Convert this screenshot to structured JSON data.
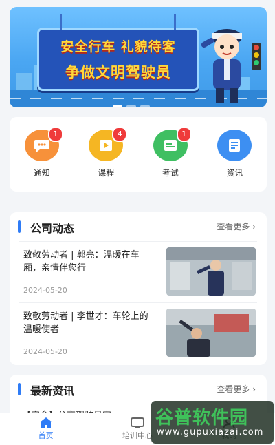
{
  "banner": {
    "line1": "安全行车 礼貌待客",
    "line2": "争做文明驾驶员"
  },
  "menu": [
    {
      "label": "通知",
      "icon": "chat-bubble-icon",
      "badge": "1",
      "color": "#f7913a"
    },
    {
      "label": "课程",
      "icon": "video-play-icon",
      "badge": "4",
      "color": "#f5b623"
    },
    {
      "label": "考试",
      "icon": "edit-note-icon",
      "badge": "1",
      "color": "#3fbf62"
    },
    {
      "label": "资讯",
      "icon": "document-icon",
      "badge": "",
      "color": "#3d8ff2"
    }
  ],
  "company": {
    "title": "公司动态",
    "more": "查看更多 ›",
    "items": [
      {
        "text": "致敬劳动者 | 郭亮：温暖在车厢，亲情伴您行",
        "date": "2024-05-20"
      },
      {
        "text": "致敬劳动者 | 李世才：车轮上的温暖使者",
        "date": "2024-05-20"
      }
    ]
  },
  "latest": {
    "title": "最新资讯",
    "more": "查看更多 ›",
    "first_item_partial": "【安全】公交驾驶员安..."
  },
  "tabs": [
    {
      "label": "首页",
      "icon": "home-icon",
      "active": true
    },
    {
      "label": "培训中心",
      "icon": "tv-icon",
      "active": false
    },
    {
      "label": "我的",
      "icon": "user-icon",
      "active": false
    }
  ],
  "watermark": {
    "name": "谷普软件园",
    "url": "www.gupuxiazai.com"
  },
  "colors": {
    "accent": "#2f7cf6",
    "badge": "#ef3b3b"
  }
}
